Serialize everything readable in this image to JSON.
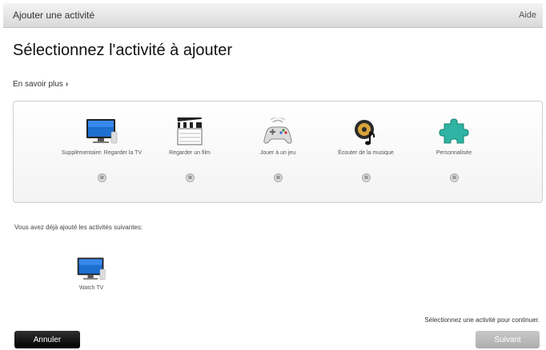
{
  "window": {
    "title": "Ajouter une activité",
    "help": "Aide"
  },
  "heading": "Sélectionnez l'activité à ajouter",
  "learn_more": "En savoir plus",
  "activities": [
    {
      "label": "Supplémentaire: Regarder la TV",
      "icon": "tv-icon"
    },
    {
      "label": "Regarder un film",
      "icon": "clapperboard-icon"
    },
    {
      "label": "Jouer à un jeu",
      "icon": "gamepad-icon"
    },
    {
      "label": "Écouter de la musique",
      "icon": "music-icon"
    },
    {
      "label": "Personnalisée",
      "icon": "puzzle-icon"
    }
  ],
  "already_added_text": "Vous avez déjà ajouté les activités suivantes:",
  "added_activities": [
    {
      "label": "Watch TV",
      "icon": "tv-icon"
    }
  ],
  "hint": "Sélectionnez une activité pour continuer.",
  "buttons": {
    "cancel": "Annuler",
    "next": "Suivant"
  }
}
